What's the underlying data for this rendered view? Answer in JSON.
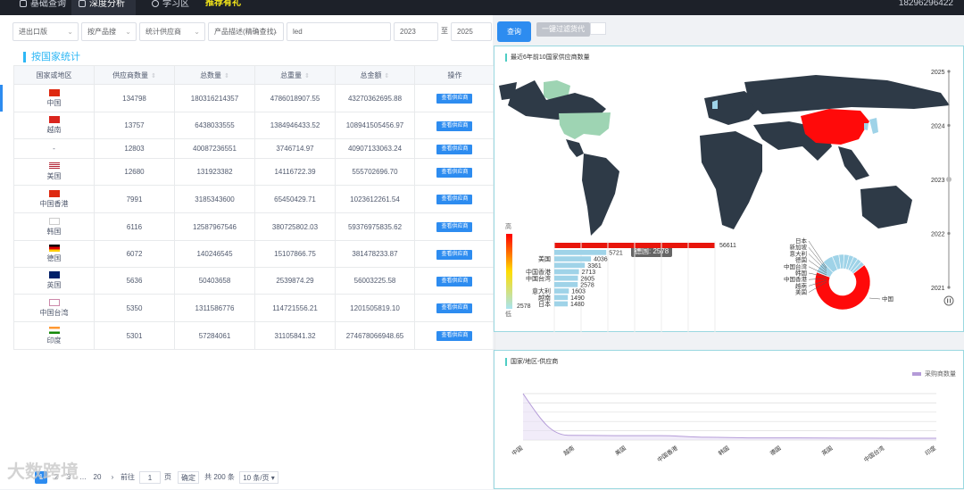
{
  "topbar": {
    "nav": [
      "基础查询",
      "深度分析",
      "学习区",
      "推荐有礼"
    ],
    "phone": "18296296422"
  },
  "filters": {
    "trade_type": "进出口版",
    "product_dim": "按产品搜",
    "stat_by": "统计供应商",
    "desc_mode": "产品描述(精确查找)",
    "keyword": "led",
    "year_from": "2023",
    "to_label": "至",
    "year_to": "2025",
    "query_label": "查询",
    "filter_label": "一键过滤货代"
  },
  "panel": {
    "title": "按国家统计"
  },
  "table": {
    "headers": [
      "国家或地区",
      "供应商数量",
      "总数量",
      "总重量",
      "总金额",
      "操作"
    ],
    "action_label": "查看供应商",
    "rows": [
      {
        "country": "中国",
        "flag": "cn",
        "suppliers": "134798",
        "qty": "180316214357",
        "weight": "4786018907.55",
        "amount": "43270362695.88"
      },
      {
        "country": "越南",
        "flag": "vn",
        "suppliers": "13757",
        "qty": "6438033555",
        "weight": "1384946433.52",
        "amount": "108941505456.97"
      },
      {
        "country": "-",
        "flag": "",
        "suppliers": "12803",
        "qty": "40087236551",
        "weight": "3746714.97",
        "amount": "40907133063.24"
      },
      {
        "country": "美国",
        "flag": "us",
        "suppliers": "12680",
        "qty": "131923382",
        "weight": "14116722.39",
        "amount": "555702696.70"
      },
      {
        "country": "中国香港",
        "flag": "hk",
        "suppliers": "7991",
        "qty": "3185343600",
        "weight": "65450429.71",
        "amount": "1023612261.54"
      },
      {
        "country": "韩国",
        "flag": "kr",
        "suppliers": "6116",
        "qty": "12587967546",
        "weight": "380725802.03",
        "amount": "59376975835.62"
      },
      {
        "country": "德国",
        "flag": "de",
        "suppliers": "6072",
        "qty": "140246545",
        "weight": "15107866.75",
        "amount": "381478233.87"
      },
      {
        "country": "英国",
        "flag": "gb",
        "suppliers": "5636",
        "qty": "50403658",
        "weight": "2539874.29",
        "amount": "56003225.58"
      },
      {
        "country": "中国台湾",
        "flag": "tw",
        "suppliers": "5350",
        "qty": "1311586776",
        "weight": "114721556.21",
        "amount": "1201505819.10"
      },
      {
        "country": "印度",
        "flag": "in",
        "suppliers": "5301",
        "qty": "57284061",
        "weight": "31105841.32",
        "amount": "274678066948.65"
      }
    ]
  },
  "pager": {
    "pages": [
      "1",
      "2",
      "3",
      "20"
    ],
    "goto_label": "前往",
    "goto_value": "1",
    "page_unit": "页",
    "confirm": "确定",
    "total": "共 200 条",
    "page_size": "10 条/页"
  },
  "watermark": "大数跨境",
  "map_chart": {
    "title": "最近6年前10国家供应商数量",
    "tooltip": "德国: 2578",
    "legend_high": "高",
    "legend_low": "低",
    "legend_min": "2578",
    "years": [
      "2025",
      "2024",
      "2023",
      "2022",
      "2021"
    ],
    "colors": {
      "china": "#ff0a0a",
      "usa": "#9ed4b3",
      "land": "#2e3a47",
      "ocean": "#ffffff"
    }
  },
  "chart_data": [
    {
      "type": "bar",
      "orientation": "horizontal",
      "categories": [
        "日本",
        "越南",
        "意大利",
        "韩国",
        "中国台湾",
        "中国香港",
        "英国",
        "美国",
        "中国"
      ],
      "values": [
        1480,
        1490,
        1603,
        2578,
        2605,
        2713,
        3361,
        4036,
        5721
      ],
      "top_value": 56611,
      "labels_visible": [
        "美国",
        "中国香港",
        "中国台湾",
        "意大利",
        "越南",
        "日本"
      ]
    },
    {
      "type": "pie",
      "donut": true,
      "labels": [
        "日本",
        "新加坡",
        "意大利",
        "德国",
        "中国台湾",
        "韩国",
        "中国香港",
        "越南",
        "美国",
        "中国"
      ]
    },
    {
      "type": "line",
      "title": "国家/地区-供应商",
      "series": [
        {
          "name": "采购商数量",
          "values": [
            134798,
            13757,
            12803,
            12680,
            7991,
            6116,
            6072,
            5636,
            5350,
            5301
          ]
        }
      ],
      "x_tick_labels": [
        "中国",
        "越南",
        "美国",
        "中国香港",
        "韩国",
        "德国",
        "英国",
        "中国台湾",
        "印度"
      ]
    }
  ]
}
